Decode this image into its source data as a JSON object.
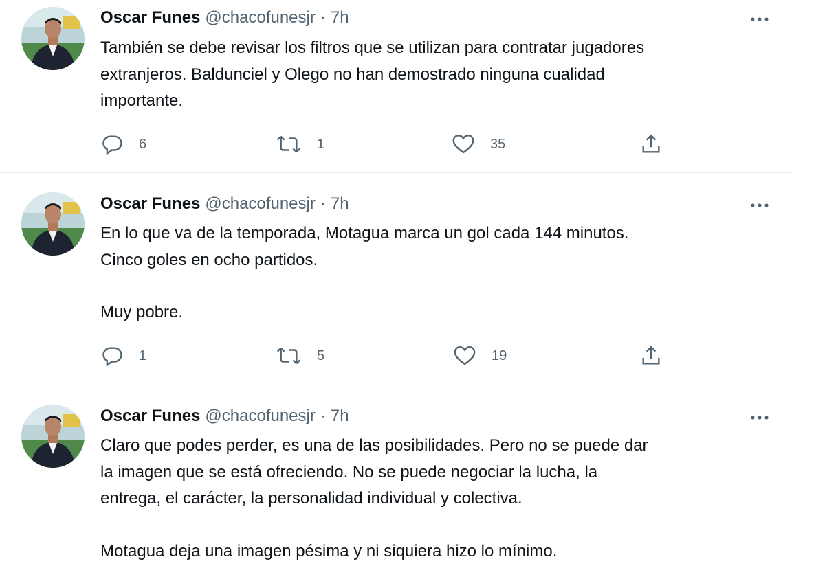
{
  "tweets": [
    {
      "author": "Oscar Funes",
      "handle": "@chacofunesjr",
      "separator": "·",
      "time": "7h",
      "lines": [
        "También se debe revisar los filtros que se utilizan para contratar jugadores",
        "extranjeros. Baldunciel y Olego no han demostrado ninguna cualidad",
        "importante."
      ],
      "replies": "6",
      "retweets": "1",
      "likes": "35"
    },
    {
      "author": "Oscar Funes",
      "handle": "@chacofunesjr",
      "separator": "·",
      "time": "7h",
      "lines": [
        "En lo que va de la temporada, Motagua marca un gol cada 144 minutos.",
        "Cinco goles en ocho partidos.",
        "",
        "Muy pobre."
      ],
      "replies": "1",
      "retweets": "5",
      "likes": "19"
    },
    {
      "author": "Oscar Funes",
      "handle": "@chacofunesjr",
      "separator": "·",
      "time": "7h",
      "lines": [
        "Claro que podes perder, es una de las posibilidades. Pero no se puede dar",
        "la imagen que se está ofreciendo. No se puede negociar la lucha, la",
        "entrega, el carácter, la personalidad individual y colectiva.",
        "",
        "Motagua deja una imagen pésima y ni siquiera hizo lo mínimo."
      ]
    }
  ],
  "icons": {
    "reply": "reply-icon",
    "retweet": "retweet-icon",
    "like": "like-icon",
    "share": "share-icon",
    "more": "more-icon"
  },
  "colors": {
    "text": "#0f1419",
    "secondary": "#536471",
    "divider": "#e6ecf0"
  }
}
